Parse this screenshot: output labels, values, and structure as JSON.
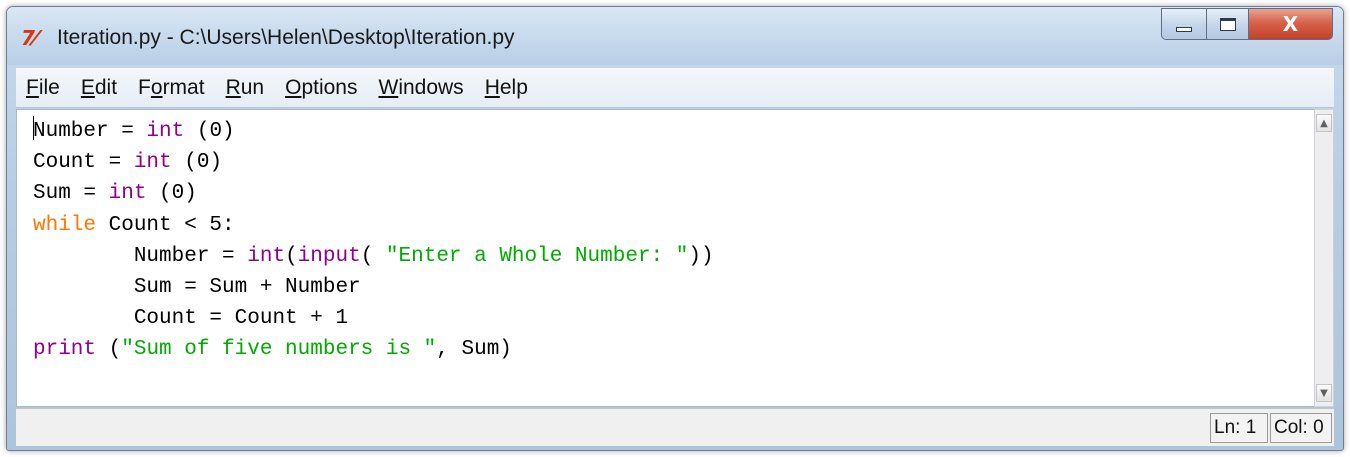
{
  "window": {
    "icon_glyph": "7⁄",
    "title": "Iteration.py - C:\\Users\\Helen\\Desktop\\Iteration.py",
    "close_glyph": "X"
  },
  "menu": [
    {
      "label": "File",
      "mnemonic_index": 0
    },
    {
      "label": "Edit",
      "mnemonic_index": 0
    },
    {
      "label": "Format",
      "mnemonic_index": 1
    },
    {
      "label": "Run",
      "mnemonic_index": 0
    },
    {
      "label": "Options",
      "mnemonic_index": 0
    },
    {
      "label": "Windows",
      "mnemonic_index": 0
    },
    {
      "label": "Help",
      "mnemonic_index": 0
    }
  ],
  "editor": {
    "lines": [
      [
        {
          "t": "Number = ",
          "k": "plain"
        },
        {
          "t": "int",
          "k": "builtin"
        },
        {
          "t": " (0)",
          "k": "plain"
        }
      ],
      [
        {
          "t": "Count = ",
          "k": "plain"
        },
        {
          "t": "int",
          "k": "builtin"
        },
        {
          "t": " (0)",
          "k": "plain"
        }
      ],
      [
        {
          "t": "Sum = ",
          "k": "plain"
        },
        {
          "t": "int",
          "k": "builtin"
        },
        {
          "t": " (0)",
          "k": "plain"
        }
      ],
      [
        {
          "t": "while",
          "k": "keyword"
        },
        {
          "t": " Count < 5:",
          "k": "plain"
        }
      ],
      [
        {
          "t": "        Number = ",
          "k": "plain"
        },
        {
          "t": "int",
          "k": "builtin"
        },
        {
          "t": "(",
          "k": "plain"
        },
        {
          "t": "input",
          "k": "builtin"
        },
        {
          "t": "( ",
          "k": "plain"
        },
        {
          "t": "\"Enter a Whole Number: \"",
          "k": "string"
        },
        {
          "t": "))",
          "k": "plain"
        }
      ],
      [
        {
          "t": "        Sum = Sum + Number",
          "k": "plain"
        }
      ],
      [
        {
          "t": "        Count = Count + 1",
          "k": "plain"
        }
      ],
      [
        {
          "t": "print",
          "k": "builtin"
        },
        {
          "t": " (",
          "k": "plain"
        },
        {
          "t": "\"Sum of five numbers is \"",
          "k": "string"
        },
        {
          "t": ", Sum)",
          "k": "plain"
        }
      ]
    ]
  },
  "status": {
    "line": "Ln: 1",
    "column": "Col: 0"
  },
  "colors": {
    "keyword": "#ff7700",
    "builtin": "#900090",
    "string": "#00aa00",
    "text": "#000000"
  }
}
